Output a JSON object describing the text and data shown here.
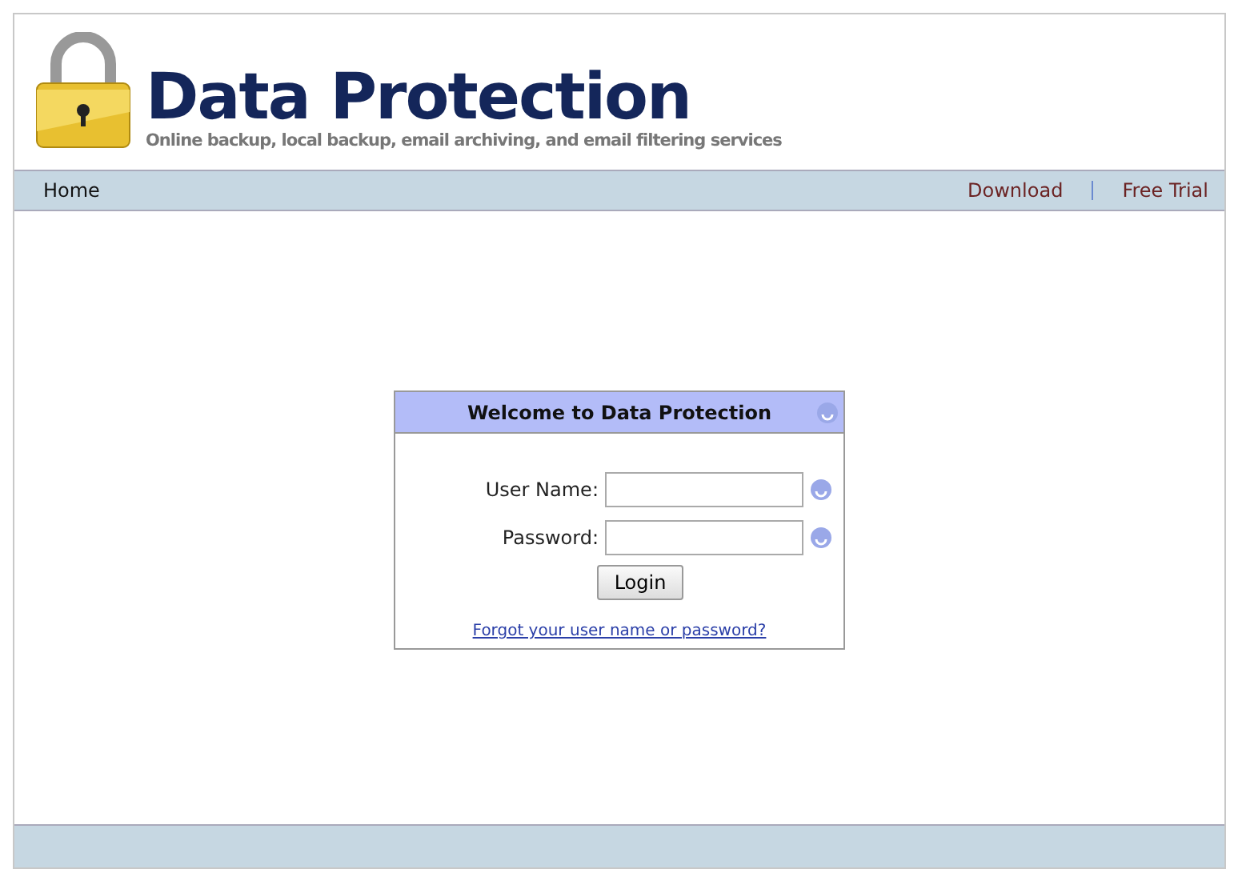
{
  "header": {
    "title": "Data Protection",
    "tagline": "Online backup, local backup, email archiving, and email filtering services"
  },
  "nav": {
    "left": [
      {
        "label": "Home"
      }
    ],
    "right": [
      {
        "label": "Download"
      },
      {
        "label": "Free Trial"
      }
    ]
  },
  "login": {
    "title": "Welcome to Data Protection",
    "fields": [
      {
        "label": "User Name:"
      },
      {
        "label": "Password:"
      }
    ],
    "button": "Login",
    "link": "Forgot your user name or password?"
  }
}
